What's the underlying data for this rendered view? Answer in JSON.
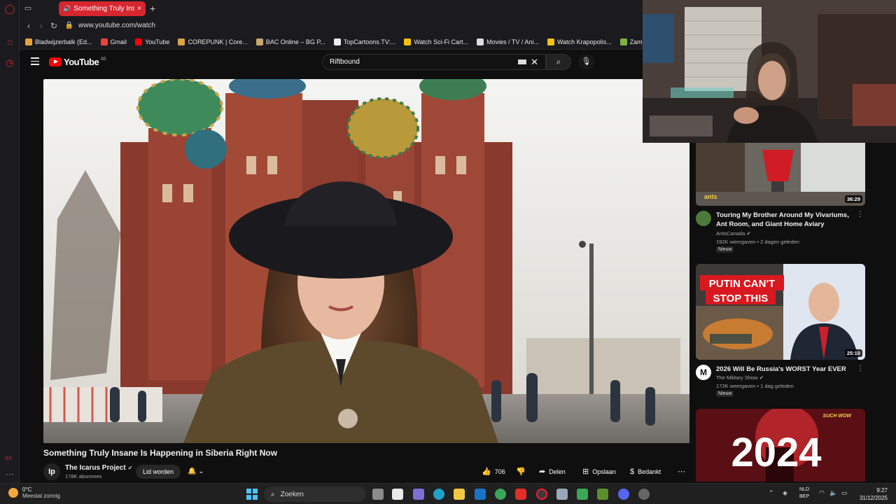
{
  "browser": {
    "active_tab_title": "Something Truly Insane",
    "url": "www.youtube.com/watch",
    "side_label": "GX",
    "bookmarks": [
      {
        "label": "Bladwijzerbalk (Ed...",
        "color": "#e8a33c"
      },
      {
        "label": "Gmail",
        "color": "#ea4335"
      },
      {
        "label": "YouTube",
        "color": "#ff0000"
      },
      {
        "label": "COREPUNK | Core...",
        "color": "#d9a441"
      },
      {
        "label": "BAC Online – BG P...",
        "color": "#c8a86b"
      },
      {
        "label": "TopCartoons.TV:...",
        "color": "#eeeeee"
      },
      {
        "label": "Watch Sci-Fi Cart...",
        "color": "#f4c20d"
      },
      {
        "label": "Movies / TV / Ani...",
        "color": "#dddddd"
      },
      {
        "label": "Watch Krapopolis...",
        "color": "#f4c20d"
      },
      {
        "label": "Zamnesia",
        "color": "#7cb342"
      }
    ]
  },
  "youtube": {
    "logo_text": "YouTube",
    "country_code": "BE",
    "search_query": "Riftbound",
    "video": {
      "title": "Something Truly Insane Is Happening in Siberia Right Now",
      "channel": "The Icarus Project",
      "channel_initial": "Ip",
      "subscribers": "178K abonnees",
      "join_label": "Lid worden",
      "likes": "706",
      "share_label": "Delen",
      "save_label": "Opslaan",
      "thanks_label": "Bedankt"
    },
    "recommendations": [
      {
        "title": "Touring My Brother Around My Vivariums, Ant Room, and Giant Home Aviary",
        "channel": "AntsCanada",
        "meta": "192K weergaven • 2 dagen geleden",
        "badge": "Nieuw",
        "duration": "36:29",
        "thumb_text": "ants"
      },
      {
        "title": "2026 Will Be Russia's WORST Year EVER",
        "channel": "The Military Show",
        "meta": "172K weergaven • 1 dag geleden",
        "badge": "Nieuw",
        "duration": "25:10",
        "thumb_text_1": "PUTIN CAN'T",
        "thumb_text_2": "STOP THIS",
        "avatar_letter": "M"
      },
      {
        "thumb_text": "2024",
        "corner_text": "SUCH WOW"
      }
    ]
  },
  "taskbar": {
    "temperature": "0°C",
    "weather": "Meestal zonnig",
    "search_label": "Zoeken",
    "language_1": "NLD",
    "language_2": "BEP",
    "time": "9:27",
    "date": "31/12/2025"
  }
}
